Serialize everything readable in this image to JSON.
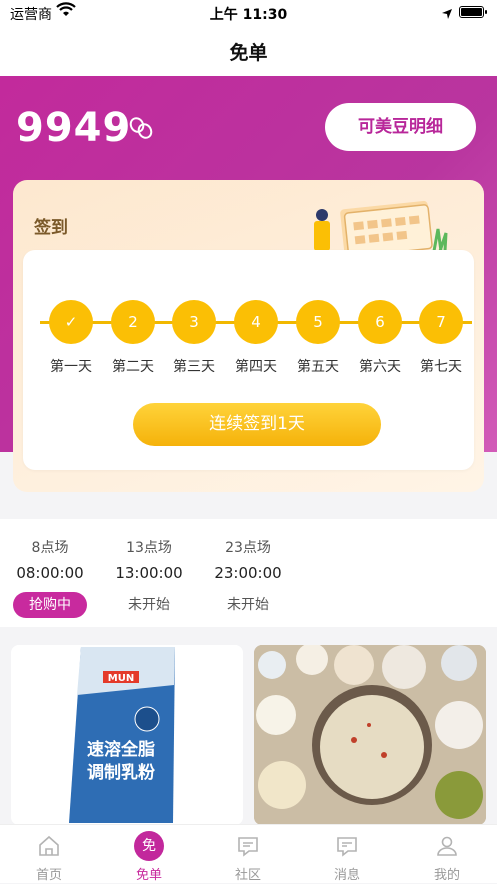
{
  "status_bar": {
    "carrier": "运营商",
    "time": "上午 11:30"
  },
  "nav": {
    "title": "免单"
  },
  "beans": {
    "count": "9949",
    "detail_button": "可美豆明细"
  },
  "checkin": {
    "title": "签到",
    "days": [
      {
        "num": "✓",
        "label": "第一天"
      },
      {
        "num": "2",
        "label": "第二天"
      },
      {
        "num": "3",
        "label": "第三天"
      },
      {
        "num": "4",
        "label": "第四天"
      },
      {
        "num": "5",
        "label": "第五天"
      },
      {
        "num": "6",
        "label": "第六天"
      },
      {
        "num": "7",
        "label": "第七天"
      }
    ],
    "button": "连续签到1天"
  },
  "sessions": [
    {
      "name": "8点场",
      "time": "08:00:00",
      "status": "抢购中"
    },
    {
      "name": "13点场",
      "time": "13:00:00",
      "status": "未开始"
    },
    {
      "name": "23点场",
      "time": "23:00:00",
      "status": "未开始"
    }
  ],
  "products": [
    {
      "brand": "MUN",
      "title_line1": "速溶全脂",
      "title_line2": "调制乳粉"
    },
    {
      "image": "hotpot"
    }
  ],
  "tabbar": {
    "items": [
      {
        "label": "首页",
        "icon": "home-icon"
      },
      {
        "label": "免单",
        "icon": "free-badge",
        "badge": "免"
      },
      {
        "label": "社区",
        "icon": "community-icon"
      },
      {
        "label": "消息",
        "icon": "message-icon"
      },
      {
        "label": "我的",
        "icon": "profile-icon"
      }
    ]
  },
  "colors": {
    "brand": "#c2289c",
    "gold": "#fbbf05"
  }
}
